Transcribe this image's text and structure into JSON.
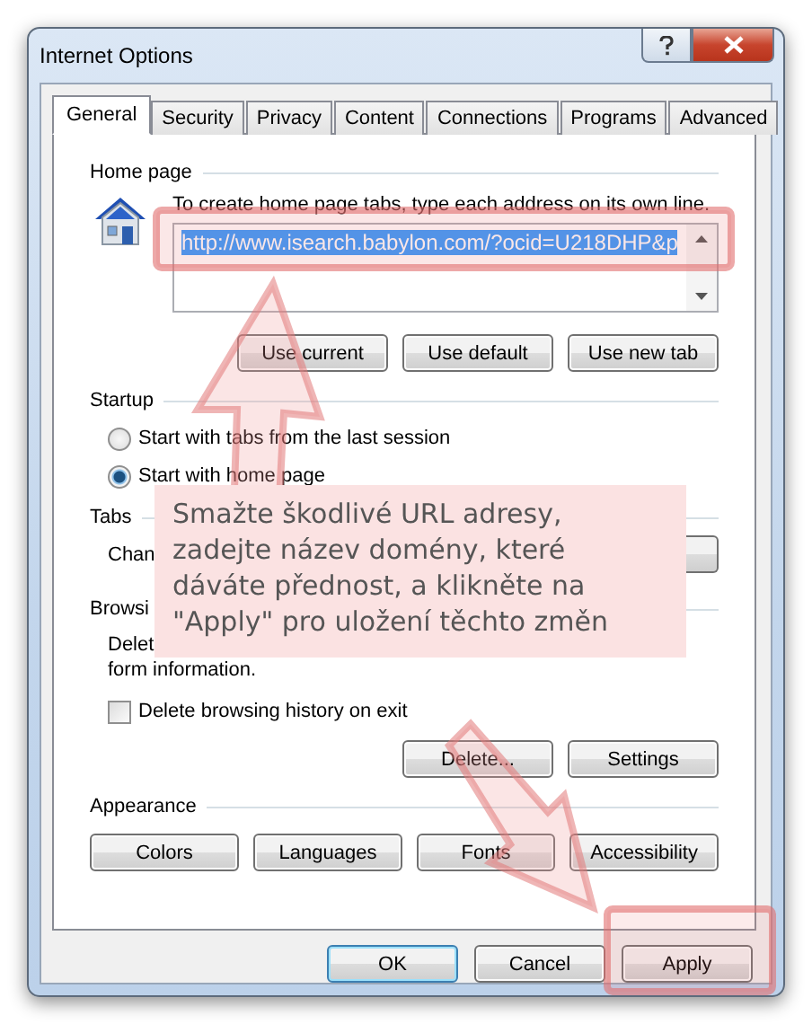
{
  "window": {
    "title": "Internet Options"
  },
  "tabs": [
    {
      "label": "General",
      "selected": true
    },
    {
      "label": "Security",
      "selected": false
    },
    {
      "label": "Privacy",
      "selected": false
    },
    {
      "label": "Content",
      "selected": false
    },
    {
      "label": "Connections",
      "selected": false
    },
    {
      "label": "Programs",
      "selected": false
    },
    {
      "label": "Advanced",
      "selected": false
    }
  ],
  "home_page": {
    "heading": "Home page",
    "hint": "To create home page tabs, type each address on its own line.",
    "url": "http://www.isearch.babylon.com/?ocid=U218DHP&p",
    "buttons": [
      "Use current",
      "Use default",
      "Use new tab"
    ]
  },
  "startup": {
    "heading": "Startup",
    "options": [
      {
        "label": "Start with tabs from the last session",
        "selected": false
      },
      {
        "label": "Start with home page",
        "selected": true
      }
    ]
  },
  "tabs_group": {
    "heading": "Tabs",
    "text": "Chan"
  },
  "browsing_history": {
    "heading": "Browsi",
    "lines": [
      "Delet",
      "form information."
    ],
    "checkbox": {
      "label": "Delete browsing history on exit",
      "checked": false
    },
    "buttons": [
      "Delete...",
      "Settings"
    ]
  },
  "appearance": {
    "heading": "Appearance",
    "buttons": [
      "Colors",
      "Languages",
      "Fonts",
      "Accessibility"
    ]
  },
  "dialog_buttons": [
    {
      "label": "OK",
      "default": true
    },
    {
      "label": "Cancel",
      "default": false
    },
    {
      "label": "Apply",
      "default": false
    }
  ],
  "annotation": {
    "text": "Smažte škodlivé URL adresy,\nzadejte název domény, které\ndáváte přednost, a klikněte na\n\"Apply\" pro uložení těchto změn"
  }
}
